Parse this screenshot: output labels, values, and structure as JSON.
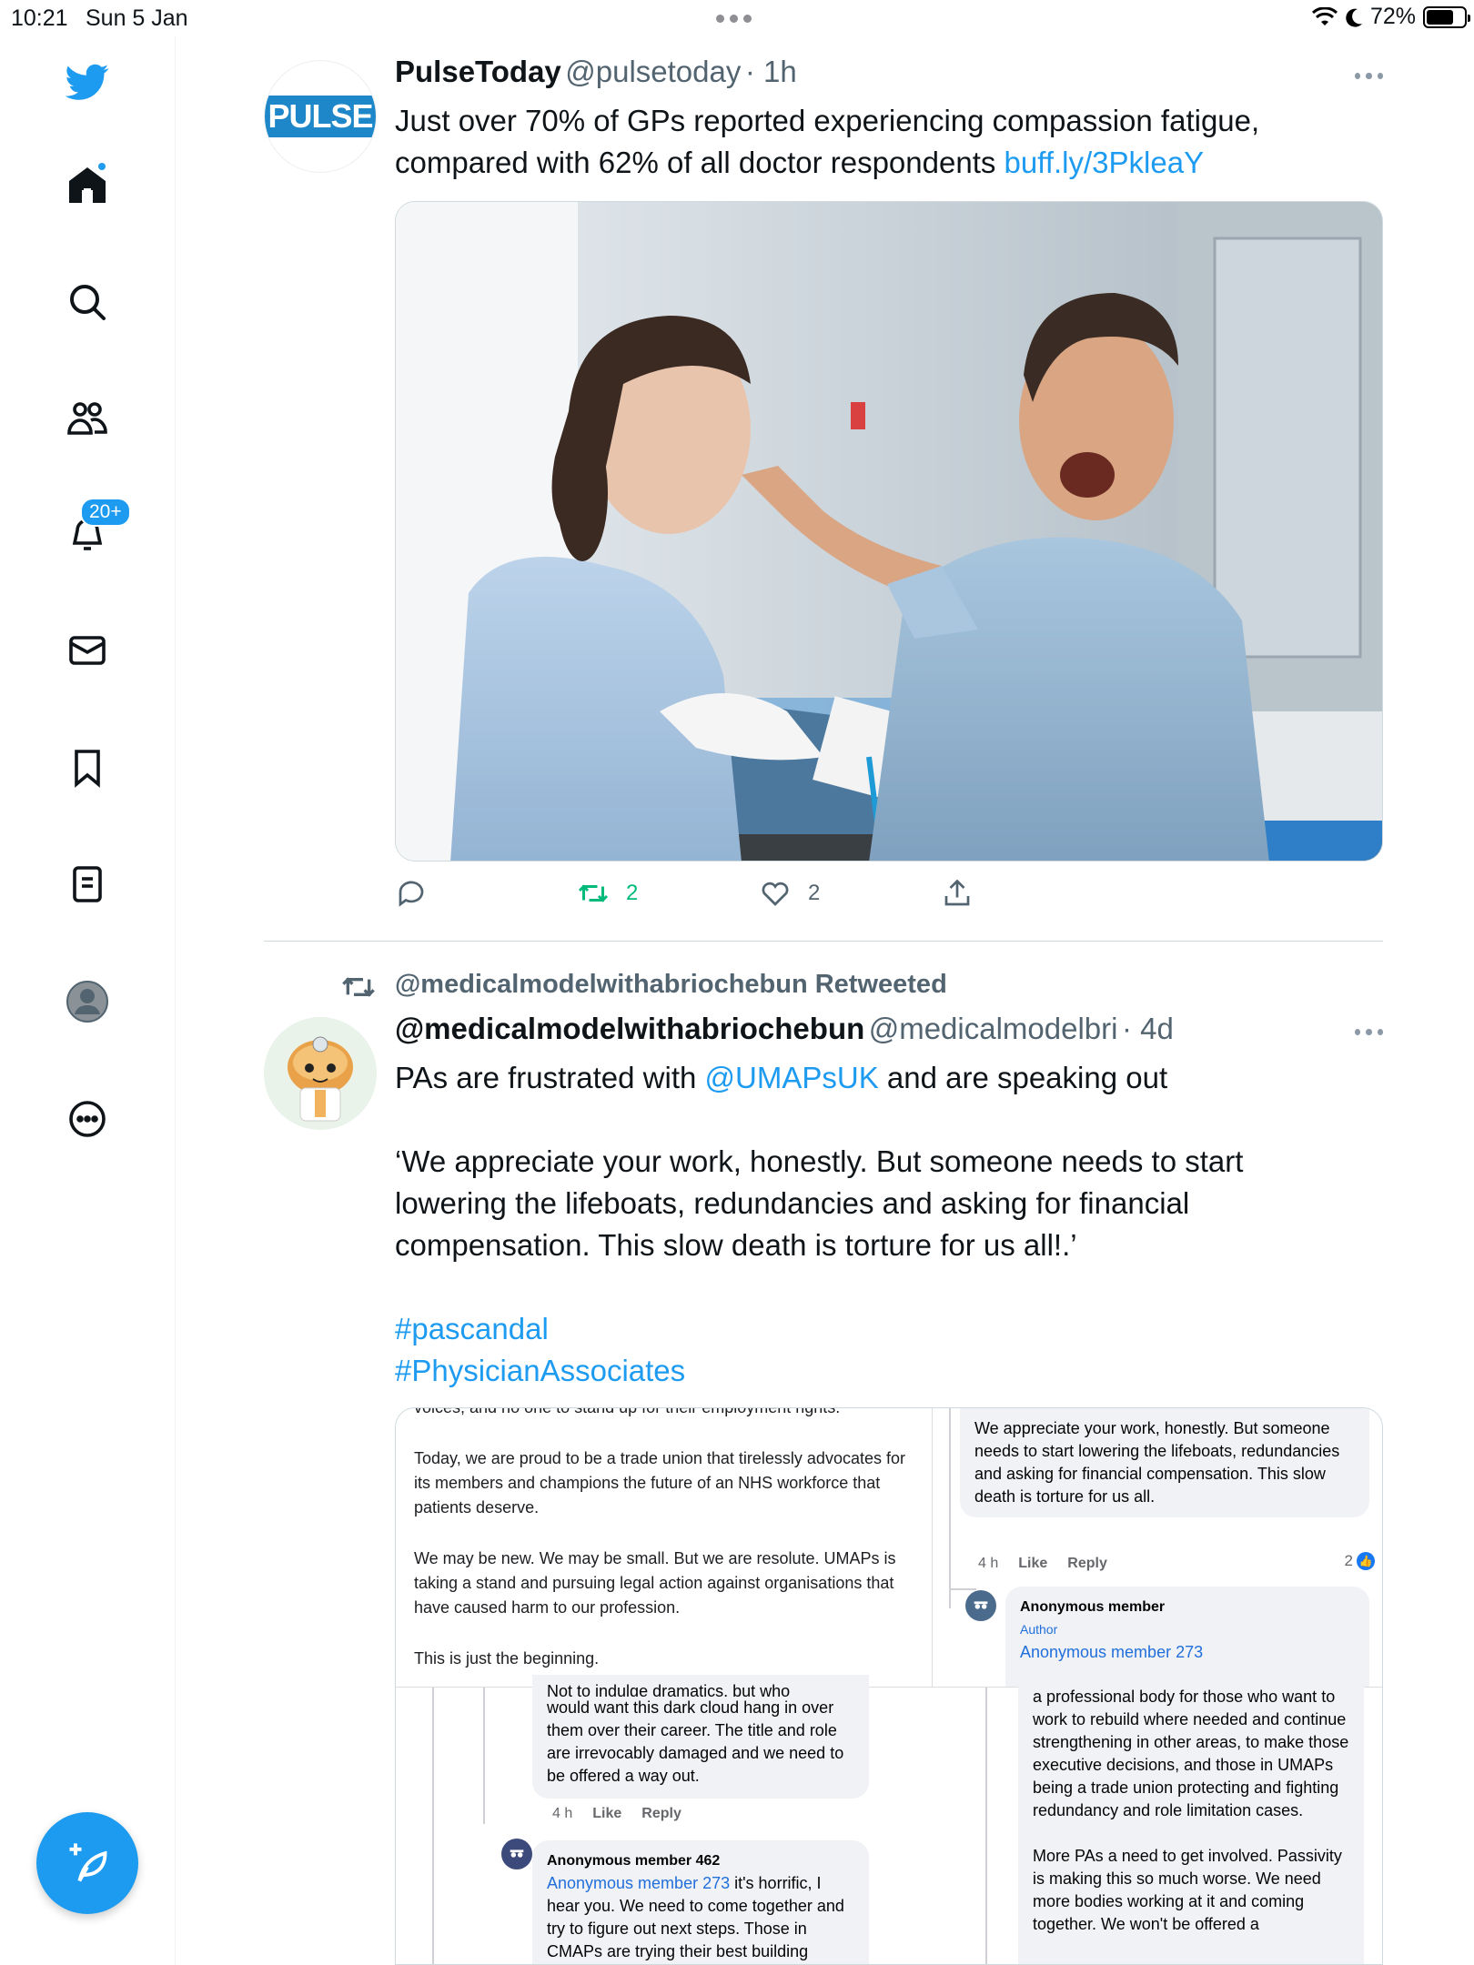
{
  "status_bar": {
    "time": "10:21",
    "date": "Sun 5 Jan",
    "battery": "72%",
    "battery_level": 0.72
  },
  "sidebar": {
    "notifications_badge": "20+"
  },
  "tweet1": {
    "name": "PulseToday",
    "handle": "@pulsetoday",
    "time": "· 1h",
    "avatar_text": "PULSE",
    "text": "Just over 70% of GPs reported experiencing compassion fatigue, compared with 62% of all doctor respondents ",
    "link": "buff.ly/3PkleaY",
    "retweets": "2",
    "likes": "2"
  },
  "tweet2": {
    "retweeted_by": "@medicalmodelwithabriochebun Retweeted",
    "name": "@medicalmodelwithabriochebun",
    "handle": "@medicalmodelbri",
    "time": "· 4d",
    "text_part1": "PAs are frustrated with ",
    "mention": "@UMAPsUK",
    "text_part2": " and are speaking out",
    "quote": "‘We appreciate your work, honestly. But someone needs to start lowering the lifeboats, redundancies and asking for financial compensation. This slow death is torture for us all!.’",
    "hashtag1": "#pascandal",
    "hashtag2": "#PhysicianAssociates"
  },
  "embedded": {
    "top_cut": "voices, and no one to stand up for their employment rights.",
    "para1": "Today, we are proud to be a trade union that tirelessly advocates for its members and champions the future of an NHS workforce that patients deserve.",
    "para2": "We may be new. We may be small. But we are resolute. UMAPs is taking a stand and pursuing legal action against organisations that have caused harm to our profession.",
    "para3": "This is just the beginning.",
    "comment1": "We appreciate your work, honestly. But someone needs to start lowering the lifeboats, redundancies and asking for financial compensation. This slow death is torture for us all.",
    "c1_time": "4 h",
    "c1_like": "Like",
    "c1_reply": "Reply",
    "c1_reacts": "2",
    "anon_name": "Anonymous member",
    "anon_author": "Author",
    "anon_text": "Anonymous member 273",
    "left_cut": "Not to indulge dramatics, but who",
    "left_bubble": "would want this dark cloud hang in over them over their career. The title and role are irrevocably damaged and we need to be offered a way out.",
    "lb_time": "4 h",
    "lb_like": "Like",
    "lb_reply": "Reply",
    "anon462_name": "Anonymous member 462",
    "anon462_mention": "Anonymous member 273",
    "anon462_text": " it's horrific, I hear you. We need to come together and try to figure out next steps. Those in CMAPs are trying their best building",
    "right_text1": "a professional body for those who want to work to rebuild where needed and continue strengthening in other areas, to make those executive decisions, and those in UMAPs being a trade union protecting and fighting redundancy and role limitation cases.",
    "right_text2": "More PAs a need to get involved. Passivity is making this so much worse. We need more bodies working at it and coming together. We won't be offered a"
  },
  "colors": {
    "accent": "#1d9bf0",
    "retweet_green": "#00ba7c"
  }
}
